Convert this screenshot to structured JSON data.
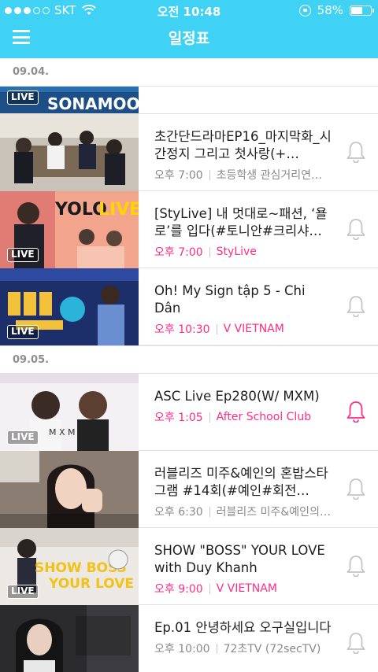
{
  "status": {
    "carrier": "SKT",
    "time": "오전 10:48",
    "battery": "58%"
  },
  "header": {
    "title": "일정표"
  },
  "colors": {
    "accent": "#3fd2f4",
    "live_pink": "#ff2d86",
    "gray_text": "#8a8a8a"
  },
  "partial_banner": {
    "label": "LIVE"
  },
  "sections": [
    {
      "date": "09.04.",
      "items": [
        {
          "title": "초간단드라마EP16_마지막화_시간정지 그리고 첫사랑(+…",
          "time": "오후 7:00",
          "channel": "초등학생 관심거리연…",
          "live": false,
          "badge": "",
          "subscribed": false
        },
        {
          "title": "[StyLive] 내 멋대로~패션, ‘욜로’를 입다(#토니안#크리샤…",
          "time": "오후 7:00",
          "channel": "StyLive",
          "live": true,
          "badge": "LIVE",
          "subscribed": false
        },
        {
          "title": "Oh! My Sign tập 5 - Chi Dân",
          "time": "오후 10:30",
          "channel": "V VIETNAM",
          "live": true,
          "badge": "LIVE",
          "subscribed": false
        }
      ]
    },
    {
      "date": "09.05.",
      "items": [
        {
          "title": "ASC Live Ep280(W/ MXM)",
          "time": "오후 1:05",
          "channel": "After School Club",
          "live": true,
          "badge": "LIVE",
          "subscribed": true
        },
        {
          "title": "러블리즈 미주&예인의 혼밥스타그램 #14회(#예인#회전…",
          "time": "오후 6:30",
          "channel": "러블리즈 미주&예인의…",
          "live": false,
          "badge": "",
          "subscribed": false
        },
        {
          "title": "SHOW \"BOSS\" YOUR LOVE with Duy Khanh",
          "time": "오후 9:00",
          "channel": "V VIETNAM",
          "live": true,
          "badge": "LIVE",
          "subscribed": false
        },
        {
          "title": "Ep.01 안녕하세요 오구실입니다",
          "time": "오후 10:00",
          "channel": "72초TV (72secTV)",
          "live": false,
          "badge": "",
          "subscribed": false
        }
      ]
    }
  ]
}
